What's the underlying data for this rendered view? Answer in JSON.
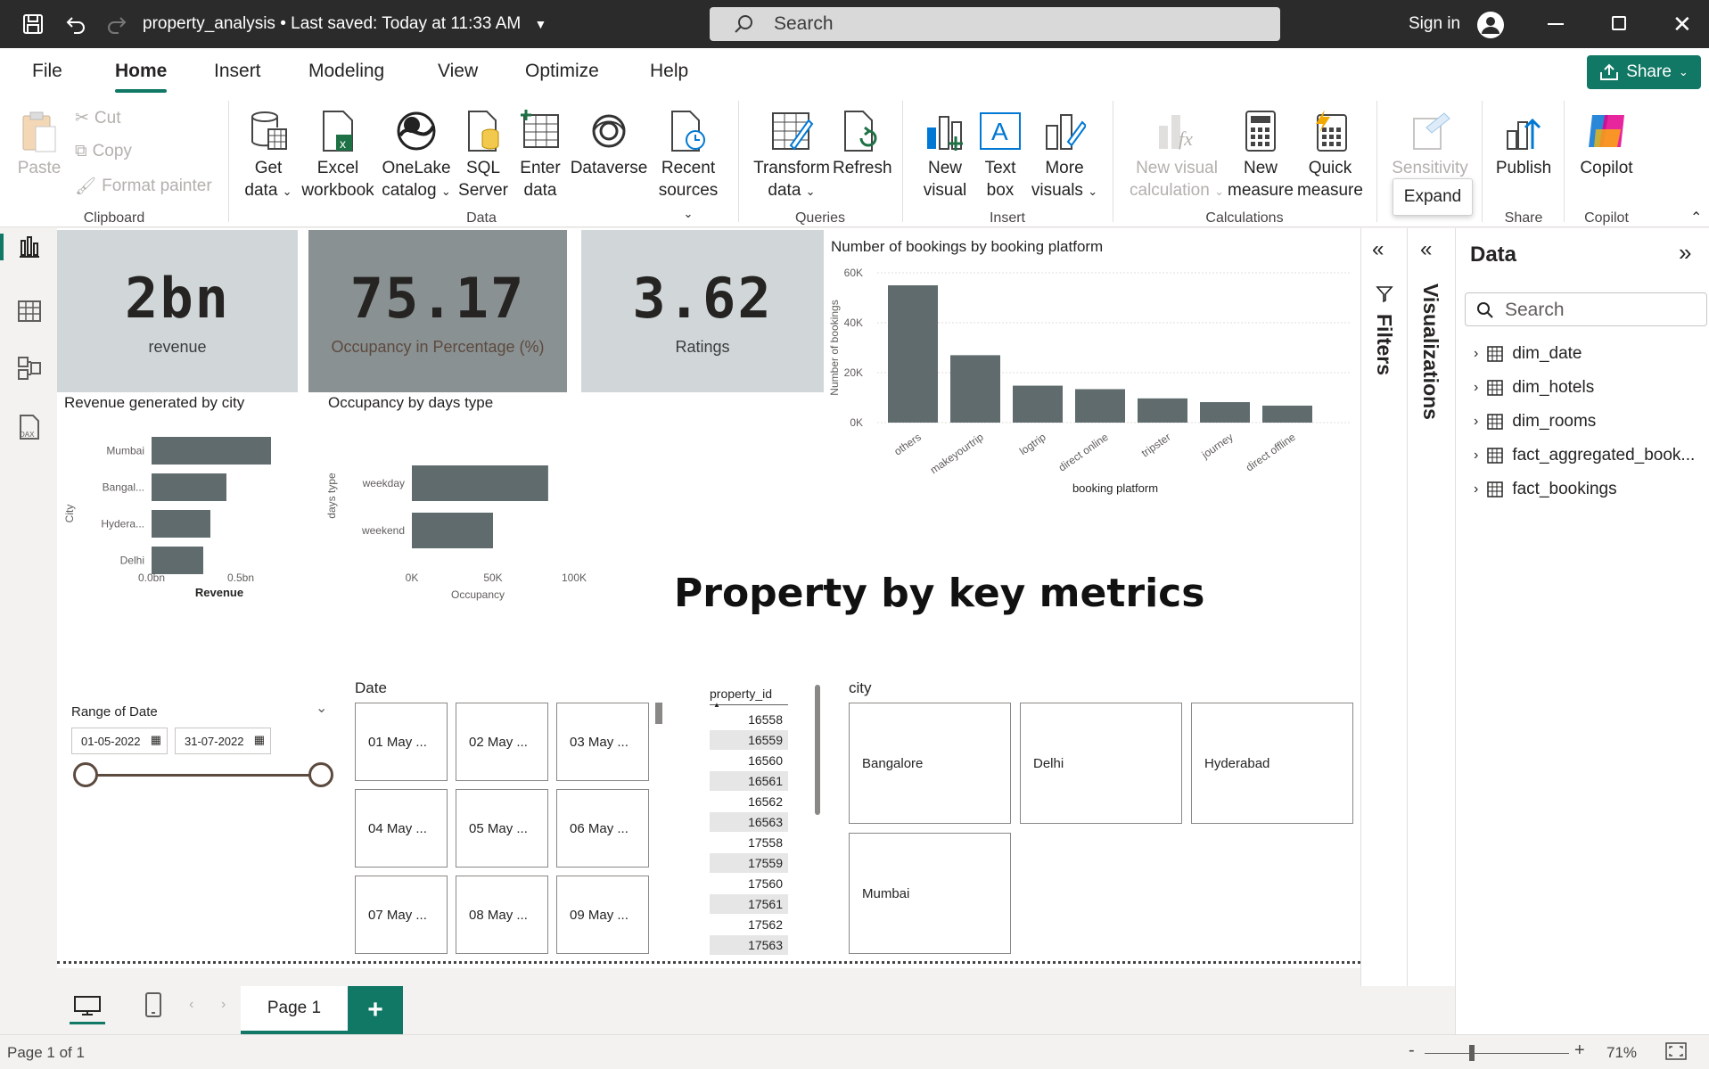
{
  "titlebar": {
    "doc_name": "property_analysis",
    "saved": "Last saved: Today at 11:33 AM",
    "search_placeholder": "Search",
    "sign_in": "Sign in"
  },
  "tabs": [
    "File",
    "Home",
    "Insert",
    "Modeling",
    "View",
    "Optimize",
    "Help"
  ],
  "share_label": "Share",
  "ribbon": {
    "clipboard": {
      "paste": "Paste",
      "cut": "Cut",
      "copy": "Copy",
      "format_painter": "Format painter",
      "group": "Clipboard"
    },
    "data": {
      "get_data": [
        "Get",
        "data"
      ],
      "excel": [
        "Excel",
        "workbook"
      ],
      "onelake": [
        "OneLake",
        "catalog"
      ],
      "sql": [
        "SQL",
        "Server"
      ],
      "enter": [
        "Enter",
        "data"
      ],
      "dataverse": "Dataverse",
      "recent": [
        "Recent",
        "sources"
      ],
      "group": "Data"
    },
    "queries": {
      "transform": [
        "Transform",
        "data"
      ],
      "refresh": "Refresh",
      "group": "Queries"
    },
    "insert": {
      "new_visual": [
        "New",
        "visual"
      ],
      "text_box": [
        "Text",
        "box"
      ],
      "more_visuals": [
        "More",
        "visuals"
      ],
      "group": "Insert"
    },
    "calculations": {
      "new_visual_calc": [
        "New visual",
        "calculation"
      ],
      "new_measure": [
        "New",
        "measure"
      ],
      "quick_measure": [
        "Quick",
        "measure"
      ],
      "group": "Calculations"
    },
    "sensitivity": {
      "label": "Sensitivity",
      "group": "Sensitivity"
    },
    "share": {
      "publish": "Publish",
      "group": "Share"
    },
    "copilot": {
      "label": "Copilot",
      "group": "Copilot"
    },
    "expand_tooltip": "Expand"
  },
  "cards": [
    {
      "value": "2bn",
      "label": "revenue"
    },
    {
      "value": "75.17",
      "label": "Occupancy in Percentage (%)"
    },
    {
      "value": "3.62",
      "label": "Ratings"
    }
  ],
  "revenue_chart": {
    "title": "Revenue generated by city",
    "chart_data": {
      "type": "bar",
      "categories": [
        "Mumbai",
        "Bangal...",
        "Hydera...",
        "Delhi"
      ],
      "values": [
        0.67,
        0.42,
        0.33,
        0.29
      ],
      "xlabel": "Revenue",
      "ylabel": "City",
      "xticks": [
        "0.0bn",
        "0.5bn"
      ],
      "xlim": [
        0,
        0.8
      ]
    }
  },
  "occupancy_chart": {
    "title": "Occupancy by days type",
    "chart_data": {
      "type": "bar",
      "categories": [
        "weekday",
        "weekend"
      ],
      "values": [
        84000,
        50000
      ],
      "xlabel": "Occupancy",
      "ylabel": "days type",
      "xticks": [
        "0K",
        "50K",
        "100K"
      ],
      "xlim": [
        0,
        100000
      ]
    }
  },
  "bookings_chart": {
    "title": "Number of bookings by booking platform",
    "chart_data": {
      "type": "bar",
      "categories": [
        "others",
        "makeyourtrip",
        "logtrip",
        "direct online",
        "tripster",
        "journey",
        "direct offline"
      ],
      "values": [
        55000,
        27000,
        14800,
        13400,
        9700,
        8200,
        6800
      ],
      "xlabel": "booking platform",
      "ylabel": "Number of bookings",
      "yticks": [
        "0K",
        "20K",
        "40K",
        "60K"
      ],
      "ylim": [
        0,
        60000
      ]
    }
  },
  "heading": "Property by key metrics",
  "date_slicer": {
    "title": "Range of Date",
    "start": "01-05-2022",
    "end": "31-07-2022"
  },
  "date_tiles": {
    "title": "Date",
    "items": [
      "01 May ...",
      "02 May ...",
      "03 May ...",
      "04 May ...",
      "05 May ...",
      "06 May ...",
      "07 May ...",
      "08 May ...",
      "09 May ..."
    ]
  },
  "property_list": {
    "header": "property_id",
    "items": [
      "16558",
      "16559",
      "16560",
      "16561",
      "16562",
      "16563",
      "17558",
      "17559",
      "17560",
      "17561",
      "17562",
      "17563"
    ]
  },
  "city_slicer": {
    "title": "city",
    "items": [
      "Bangalore",
      "Delhi",
      "Hyderabad",
      "Mumbai"
    ]
  },
  "panes": {
    "filters": "Filters",
    "visualizations": "Visualizations",
    "data_title": "Data",
    "search_placeholder": "Search",
    "tables": [
      "dim_date",
      "dim_hotels",
      "dim_rooms",
      "fact_aggregated_book...",
      "fact_bookings"
    ]
  },
  "pages": {
    "current": "Page 1",
    "status": "Page 1 of 1",
    "zoom": "71%"
  },
  "colors": {
    "accent": "#117865",
    "bar": "#5f6b6d",
    "card": "#d1d7d9",
    "card_dark": "#8a9192"
  }
}
